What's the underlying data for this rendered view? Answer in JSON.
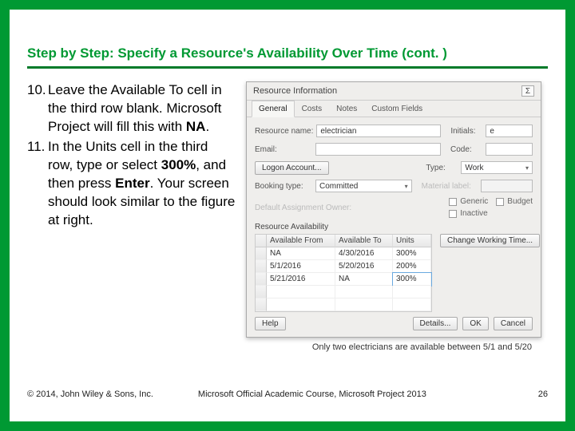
{
  "heading": "Step by Step: Specify a Resource's Availability Over Time (cont. )",
  "steps": {
    "n10": "10.",
    "t10a": "Leave the Available To cell in the third row blank. Microsoft Project will fill this with ",
    "t10b": "NA",
    "t10c": ".",
    "n11": "11.",
    "t11a": "In the Units cell in the third row, type or select ",
    "t11b": "300%",
    "t11c": ", and then press ",
    "t11d": "Enter",
    "t11e": ". Your screen should look similar to the figure at right."
  },
  "dialog": {
    "title": "Resource Information",
    "tabs": [
      "General",
      "Costs",
      "Notes",
      "Custom Fields"
    ],
    "labels": {
      "resource_name": "Resource name:",
      "initials": "Initials:",
      "email": "Email:",
      "code": "Code:",
      "logon": "Logon Account...",
      "booking": "Booking type:",
      "type": "Type:",
      "material": "Material label:",
      "default_owner": "Default Assignment Owner:",
      "section": "Resource Availability",
      "generic": "Generic",
      "budget": "Budget",
      "inactive": "Inactive",
      "change_time": "Change Working Time...",
      "help": "Help",
      "details": "Details...",
      "ok": "OK",
      "cancel": "Cancel"
    },
    "values": {
      "resource_name": "electrician",
      "initials": "e",
      "booking": "Committed",
      "type": "Work"
    },
    "table": {
      "headers": [
        "Available From",
        "Available To",
        "Units"
      ],
      "rows": [
        [
          "NA",
          "4/30/2016",
          "300%"
        ],
        [
          "5/1/2016",
          "5/20/2016",
          "200%"
        ],
        [
          "5/21/2016",
          "NA",
          "300%"
        ]
      ]
    }
  },
  "caption": "Only two electricians are available between 5/1 and 5/20",
  "footer": {
    "copyright": "© 2014, John Wiley & Sons, Inc.",
    "course": "Microsoft Official Academic Course, Microsoft Project 2013",
    "page": "26"
  }
}
